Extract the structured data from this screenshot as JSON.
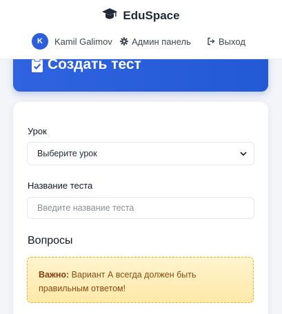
{
  "header": {
    "brand": "EduSpace",
    "user": {
      "initial": "K",
      "name": "Kamil Galimov"
    },
    "admin_label": "Админ панель",
    "logout_label": "Выход"
  },
  "banner": {
    "title": "Создать тест"
  },
  "form": {
    "lesson_label": "Урок",
    "lesson_select_value": "Выберите урок",
    "test_name_label": "Название теста",
    "test_name_placeholder": "Введите название теста",
    "test_name_value": ""
  },
  "questions": {
    "title": "Вопросы",
    "notice_strong": "Важно:",
    "notice_text": " Вариант А всегда должен быть правильным ответом!"
  },
  "colors": {
    "accent": "#2b5fdc",
    "banner": "#2f63df",
    "warning_bg": "#ffeebb",
    "warning_border": "#f2b01e",
    "warning_text": "#8a4a10"
  },
  "icons": [
    "graduation-cap-icon",
    "gear-icon",
    "logout-icon",
    "clipboard-check-icon",
    "chevron-down-icon"
  ]
}
